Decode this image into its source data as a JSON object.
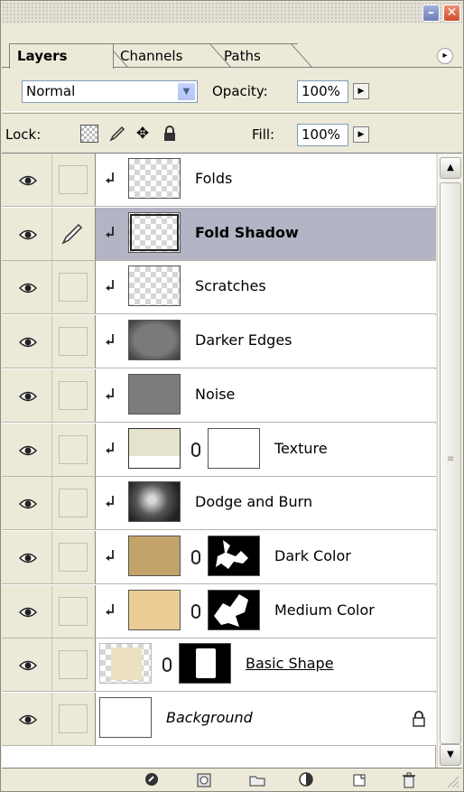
{
  "window": {
    "minimize_glyph": "–",
    "close_glyph": "✕"
  },
  "tabs": [
    {
      "label": "Layers",
      "active": true
    },
    {
      "label": "Channels",
      "active": false
    },
    {
      "label": "Paths",
      "active": false
    }
  ],
  "panel_menu_glyph": "▸",
  "blend_mode": {
    "value": "Normal",
    "options_visible": [
      "Normal"
    ]
  },
  "opacity": {
    "label": "Opacity:",
    "value": "100%"
  },
  "lock": {
    "label": "Lock:",
    "icons": [
      "lock-transparent-icon",
      "lock-image-brush-icon",
      "lock-position-move-icon",
      "lock-all-padlock-icon"
    ]
  },
  "fill": {
    "label": "Fill:",
    "value": "100%"
  },
  "layers": [
    {
      "name": "Folds",
      "visible": true,
      "clipped": true,
      "thumb": "checker"
    },
    {
      "name": "Fold Shadow",
      "visible": true,
      "clipped": true,
      "thumb": "checker",
      "selected": true,
      "brush_active": true
    },
    {
      "name": "Scratches",
      "visible": true,
      "clipped": true,
      "thumb": "checker"
    },
    {
      "name": "Darker Edges",
      "visible": true,
      "clipped": true,
      "thumb": "edges"
    },
    {
      "name": "Noise",
      "visible": true,
      "clipped": true,
      "thumb": "noise"
    },
    {
      "name": "Texture",
      "visible": true,
      "clipped": true,
      "thumb": "texture",
      "mask": "white"
    },
    {
      "name": "Dodge and Burn",
      "visible": true,
      "clipped": true,
      "thumb": "dodge"
    },
    {
      "name": "Dark Color",
      "visible": true,
      "clipped": true,
      "thumb": "tan",
      "mask": "splotch"
    },
    {
      "name": "Medium Color",
      "visible": true,
      "clipped": true,
      "thumb": "beige",
      "mask": "splotch2"
    },
    {
      "name": "Basic Shape",
      "visible": true,
      "clipped": false,
      "thumb": "checker-beige",
      "mask": "shape",
      "underlined": true
    },
    {
      "name": "Background",
      "visible": true,
      "clipped": false,
      "thumb": "white",
      "italic": true,
      "locked": true
    }
  ],
  "bottom_icons": [
    "link-layers-icon",
    "layer-style-icon",
    "add-mask-icon",
    "new-group-icon",
    "adjustment-layer-icon",
    "new-layer-icon",
    "trash-icon"
  ],
  "colors": {
    "panel_bg": "#ece9d8",
    "selected_row": "#b3b5c4",
    "tan": "#c2a46a",
    "beige": "#ebcc94"
  }
}
